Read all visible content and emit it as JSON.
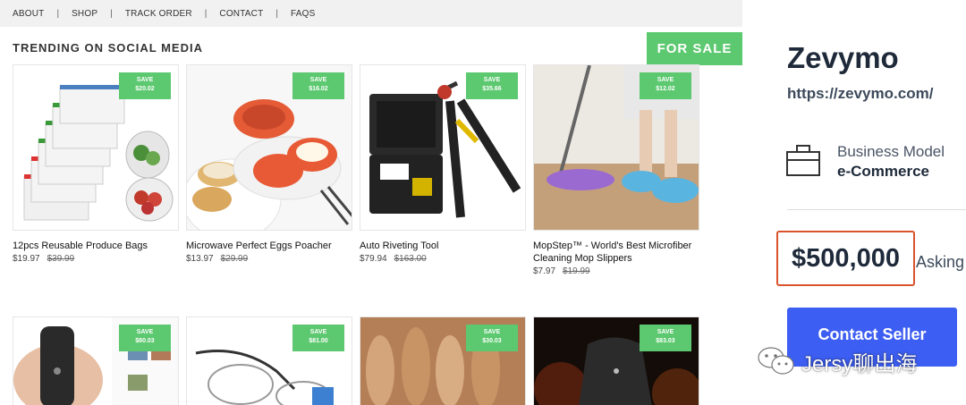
{
  "nav": {
    "links": [
      "ABOUT",
      "SHOP",
      "TRACK ORDER",
      "CONTACT",
      "FAQS"
    ]
  },
  "section_title": "TRENDING ON SOCIAL MEDIA",
  "for_sale_label": "FOR SALE",
  "save_label": "SAVE",
  "products": [
    {
      "name": "12pcs Reusable Produce Bags",
      "price": "$19.97",
      "old_price": "$39.99",
      "save": "$20.02"
    },
    {
      "name": "Microwave Perfect Eggs Poacher",
      "price": "$13.97",
      "old_price": "$29.99",
      "save": "$16.02"
    },
    {
      "name": "Auto Riveting Tool",
      "price": "$79.94",
      "old_price": "$163.00",
      "save": "$35.66"
    },
    {
      "name": "MopStep™ - World's Best Microfiber Cleaning Mop Slippers",
      "price": "$7.97",
      "old_price": "$19.99",
      "save": "$12.02"
    }
  ],
  "products_row2": [
    {
      "save": "$80.03"
    },
    {
      "save": "$81.00"
    },
    {
      "save": "$30.03"
    },
    {
      "save": "$83.03"
    }
  ],
  "panel": {
    "company": "Zevymo",
    "url": "https://zevymo.com/",
    "business_model_label": "Business Model",
    "business_model_value": "e-Commerce",
    "price": "$500,000",
    "asking_label": "Asking",
    "contact_button": "Contact Seller"
  },
  "watermark": {
    "text": "Jersy聊出海",
    "icon": "wechat-icon"
  },
  "colors": {
    "accent_green": "#5cc86f",
    "button_blue": "#3d5ef2",
    "price_border": "#d9532c"
  }
}
